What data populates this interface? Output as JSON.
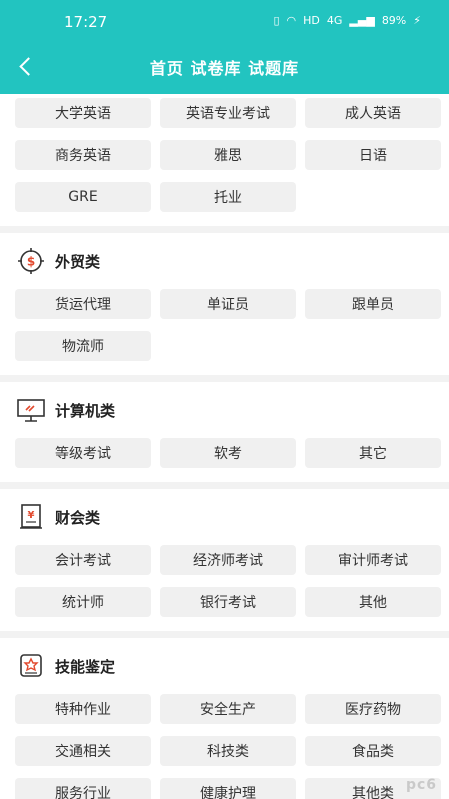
{
  "status": {
    "time": "17:27",
    "network": "HD",
    "signal": "4G",
    "battery": "89%"
  },
  "nav": {
    "title": "首页 试卷库 试题库"
  },
  "sections": [
    {
      "title": "",
      "items": [
        "大学英语",
        "英语专业考试",
        "成人英语",
        "商务英语",
        "雅思",
        "日语",
        "GRE",
        "托业"
      ]
    },
    {
      "title": "外贸类",
      "icon": "dollar-icon",
      "items": [
        "货运代理",
        "单证员",
        "跟单员",
        "物流师"
      ]
    },
    {
      "title": "计算机类",
      "icon": "computer-icon",
      "items": [
        "等级考试",
        "软考",
        "其它"
      ]
    },
    {
      "title": "财会类",
      "icon": "accounting-book-icon",
      "items": [
        "会计考试",
        "经济师考试",
        "审计师考试",
        "统计师",
        "银行考试",
        "其他"
      ]
    },
    {
      "title": "技能鉴定",
      "icon": "badge-icon",
      "items": [
        "特种作业",
        "安全生产",
        "医疗药物",
        "交通相关",
        "科技类",
        "食品类",
        "服务行业",
        "健康护理",
        "其他类"
      ]
    }
  ],
  "watermark": "pc6"
}
